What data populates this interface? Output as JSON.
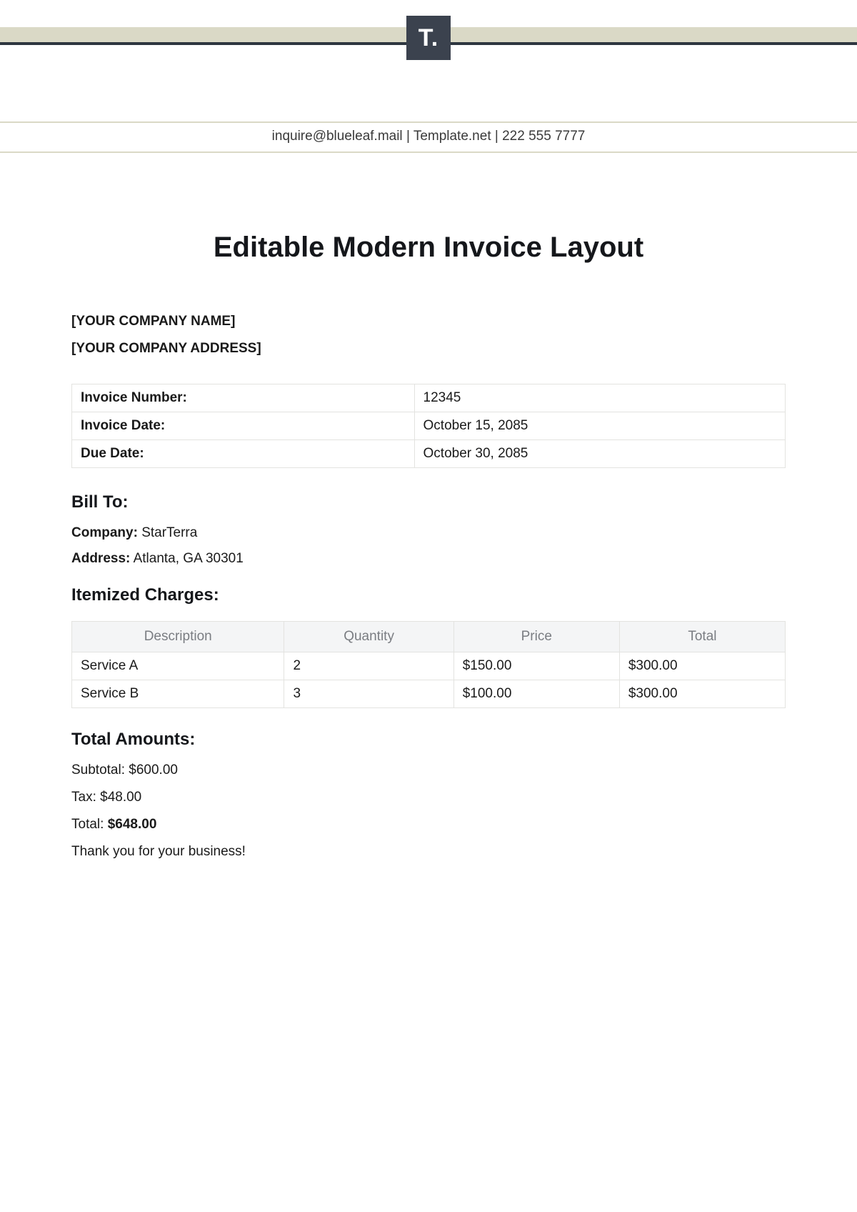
{
  "logo_text": "T.",
  "contact": {
    "email": "inquire@blueleaf.mail",
    "site": "Template.net",
    "phone": "222 555 7777",
    "sep": "  |  "
  },
  "title": "Editable Modern Invoice Layout",
  "company": {
    "name": "[YOUR COMPANY NAME]",
    "address": "[YOUR COMPANY ADDRESS]"
  },
  "meta": {
    "labels": {
      "invoice_no": "Invoice Number:",
      "invoice_date": "Invoice Date:",
      "due_date": "Due Date:"
    },
    "invoice_no": "12345",
    "invoice_date": "October 15, 2085",
    "due_date": "October 30, 2085"
  },
  "bill_to": {
    "heading": "Bill To:",
    "company_label": "Company:",
    "company": "StarTerra",
    "address_label": "Address:",
    "address": "Atlanta, GA 30301"
  },
  "items_heading": "Itemized Charges:",
  "items_columns": {
    "desc": "Description",
    "qty": "Quantity",
    "price": "Price",
    "total": "Total"
  },
  "items": [
    {
      "desc": "Service A",
      "qty": "2",
      "price": "$150.00",
      "total": "$300.00"
    },
    {
      "desc": "Service B",
      "qty": "3",
      "price": "$100.00",
      "total": "$300.00"
    }
  ],
  "totals": {
    "heading": "Total Amounts:",
    "subtotal_label": "Subtotal: ",
    "subtotal": "$600.00",
    "tax_label": "Tax: ",
    "tax": "$48.00",
    "total_label": "Total: ",
    "total": "$648.00"
  },
  "thanks": "Thank you for your business!"
}
